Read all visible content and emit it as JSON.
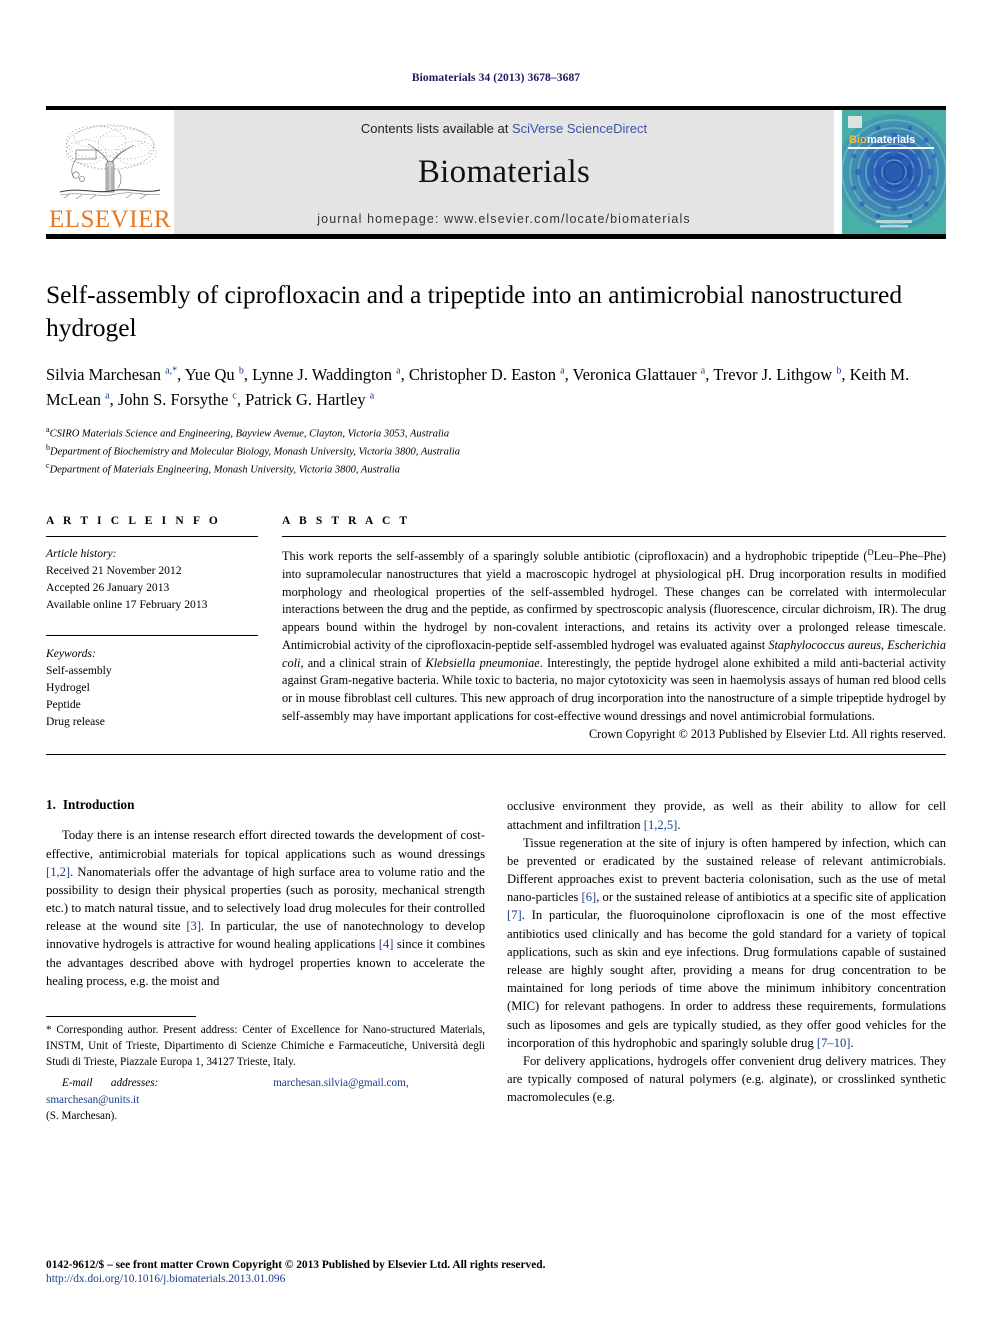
{
  "running_head": "Biomaterials 34 (2013) 3678–3687",
  "masthead": {
    "publisher_name": "ELSEVIER",
    "contents_prefix": "Contents lists available at ",
    "contents_link": "SciVerse ScienceDirect",
    "journal_name": "Biomaterials",
    "homepage": "journal homepage: www.elsevier.com/locate/biomaterials",
    "cover_title_a": "Bio",
    "cover_title_b": "materials"
  },
  "article": {
    "title": "Self-assembly of ciprofloxacin and a tripeptide into an antimicrobial nanostructured hydrogel",
    "authors_html": "Silvia Marchesan <sup>a,</sup><sup>*</sup>, Yue Qu <sup>b</sup>, Lynne J. Waddington <sup>a</sup>, Christopher D. Easton <sup>a</sup>, Veronica Glattauer <sup>a</sup>, Trevor J. Lithgow <sup>b</sup>, Keith M. McLean <sup>a</sup>, John S. Forsythe <sup>c</sup>, Patrick G. Hartley <sup>a</sup>",
    "affiliations": [
      {
        "marker": "a",
        "text": "CSIRO Materials Science and Engineering, Bayview Avenue, Clayton, Victoria 3053, Australia"
      },
      {
        "marker": "b",
        "text": "Department of Biochemistry and Molecular Biology, Monash University, Victoria 3800, Australia"
      },
      {
        "marker": "c",
        "text": "Department of Materials Engineering, Monash University, Victoria 3800, Australia"
      }
    ]
  },
  "article_info": {
    "heading": "A R T I C L E    I N F O",
    "history_label": "Article history:",
    "history": [
      "Received 21 November 2012",
      "Accepted 26 January 2013",
      "Available online 17 February 2013"
    ],
    "keywords_label": "Keywords:",
    "keywords": [
      "Self-assembly",
      "Hydrogel",
      "Peptide",
      "Drug release"
    ]
  },
  "abstract": {
    "heading": "A B S T R A C T",
    "text_html": "This work reports the self-assembly of a sparingly soluble antibiotic (ciprofloxacin) and a hydrophobic tripeptide (<span class=\"sup\">D</span>Leu–Phe–Phe) into supramolecular nanostructures that yield a macroscopic hydrogel at physiological pH. Drug incorporation results in modified morphology and rheological properties of the self-assembled hydrogel. These changes can be correlated with intermolecular interactions between the drug and the peptide, as confirmed by spectroscopic analysis (fluorescence, circular dichroism, IR). The drug appears bound within the hydrogel by non-covalent interactions, and retains its activity over a prolonged release timescale. Antimicrobial activity of the ciprofloxacin-peptide self-assembled hydrogel was evaluated against <i>Staphylococcus aureus</i>, <i>Escherichia coli</i>, and a clinical strain of <i>Klebsiella pneumoniae</i>. Interestingly, the peptide hydrogel alone exhibited a mild anti-bacterial activity against Gram-negative bacteria. While toxic to bacteria, no major cytotoxicity was seen in haemolysis assays of human red blood cells or in mouse fibroblast cell cultures. This new approach of drug incorporation into the nanostructure of a simple tripeptide hydrogel by self-assembly may have important applications for cost-effective wound dressings and novel antimicrobial formulations.",
    "copyright": "Crown Copyright © 2013 Published by Elsevier Ltd. All rights reserved."
  },
  "sections": {
    "intro_number": "1.",
    "intro_title": "Introduction",
    "left_paragraphs_html": [
      "Today there is an intense research effort directed towards the development of cost-effective, antimicrobial materials for topical applications such as wound dressings <span class=\"ref\">[1,2]</span>. Nanomaterials offer the advantage of high surface area to volume ratio and the possibility to design their physical properties (such as porosity, mechanical strength etc.) to match natural tissue, and to selectively load drug molecules for their controlled release at the wound site <span class=\"ref\">[3]</span>. In particular, the use of nanotechnology to develop innovative hydrogels is attractive for wound healing applications <span class=\"ref\">[4]</span> since it combines the advantages described above with hydrogel properties known to accelerate the healing process, e.g. the moist and"
    ],
    "right_paragraphs_html": [
      "occlusive environment they provide, as well as their ability to allow for cell attachment and infiltration <span class=\"ref\">[1,2,5]</span>.",
      "Tissue regeneration at the site of injury is often hampered by infection, which can be prevented or eradicated by the sustained release of relevant antimicrobials. Different approaches exist to prevent bacteria colonisation, such as the use of metal nano-particles <span class=\"ref\">[6]</span>, or the sustained release of antibiotics at a specific site of application <span class=\"ref\">[7]</span>. In particular, the fluoroquinolone ciprofloxacin is one of the most effective antibiotics used clinically and has become the gold standard for a variety of topical applications, such as skin and eye infections. Drug formulations capable of sustained release are highly sought after, providing a means for drug concentration to be maintained for long periods of time above the minimum inhibitory concentration (MIC) for relevant pathogens. In order to address these requirements, formulations such as liposomes and gels are typically studied, as they offer good vehicles for the incorporation of this hydrophobic and sparingly soluble drug <span class=\"ref\">[7–10]</span>.",
      "For delivery applications, hydrogels offer convenient drug delivery matrices. They are typically composed of natural polymers (e.g. alginate), or crosslinked synthetic macromolecules (e.g."
    ]
  },
  "footnotes": {
    "corresponding_html": "* Corresponding author. Present address: Center of Excellence for Nano-structured Materials, INSTM, Unit of Trieste, Dipartimento di Scienze Chimiche e Farmaceutiche, Università degli Studi di Trieste, Piazzale Europa 1, 34127 Trieste, Italy.",
    "email_label": "E-mail addresses:",
    "email_1": "marchesan.silvia@gmail.com,",
    "email_2": "smarchesan@units.it",
    "email_attrib": "(S. Marchesan)."
  },
  "legal": {
    "issn_line": "0142-9612/$ – see front matter Crown Copyright © 2013 Published by Elsevier Ltd. All rights reserved.",
    "doi": "http://dx.doi.org/10.1016/j.biomaterials.2013.01.096"
  },
  "colors": {
    "elsevier_orange": "#E87722",
    "link_blue": "#3b55a6",
    "ref_blue": "#1a3e8c",
    "band_grey": "#e4e4e4",
    "cover_teal": "#3fa8a8",
    "cover_blue": "#1b3fa0"
  }
}
